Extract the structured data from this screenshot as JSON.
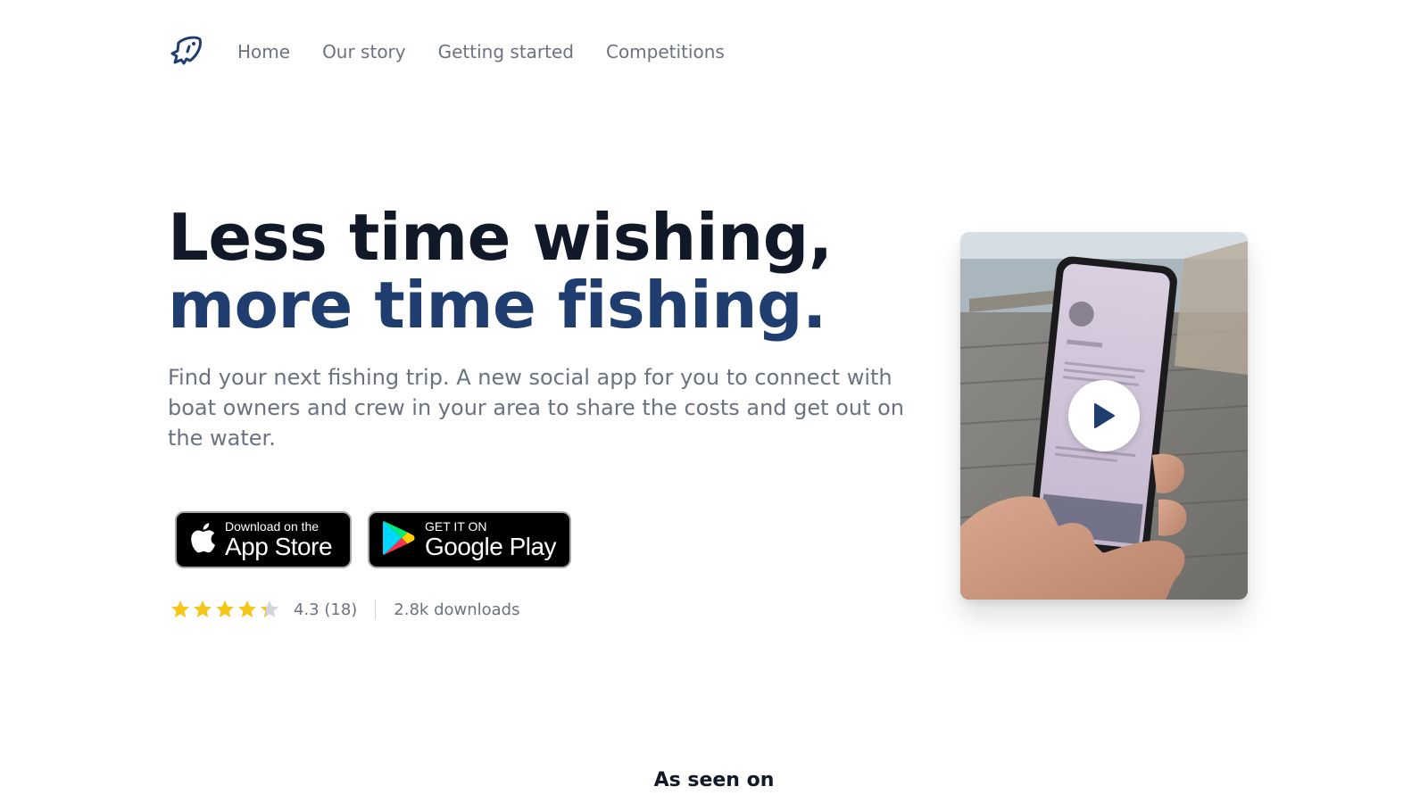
{
  "nav": {
    "logo_icon": "fish-logo-icon",
    "links": [
      "Home",
      "Our story",
      "Getting started",
      "Competitions"
    ]
  },
  "hero": {
    "headline_line1": "Less time wishing,",
    "headline_line2": "more time fishing.",
    "subtext": "Find your next fishing trip. A new social app for you to connect with boat owners and crew in your area to share the costs and get out on the water.",
    "app_store": {
      "small": "Download on the",
      "big": "App Store",
      "icon": "apple-icon"
    },
    "google_play": {
      "small": "GET IT ON",
      "big": "Google Play",
      "icon": "google-play-icon"
    },
    "rating": {
      "stars": 4.3,
      "text": "4.3 (18)",
      "downloads": "2.8k downloads"
    }
  },
  "video": {
    "icon": "play-icon"
  },
  "seen_on": {
    "title": "As seen on"
  },
  "colors": {
    "brand_navy": "#1f3d6e",
    "headline_dark": "#111827",
    "muted_text": "#6b7280",
    "star": "#f5c518"
  }
}
